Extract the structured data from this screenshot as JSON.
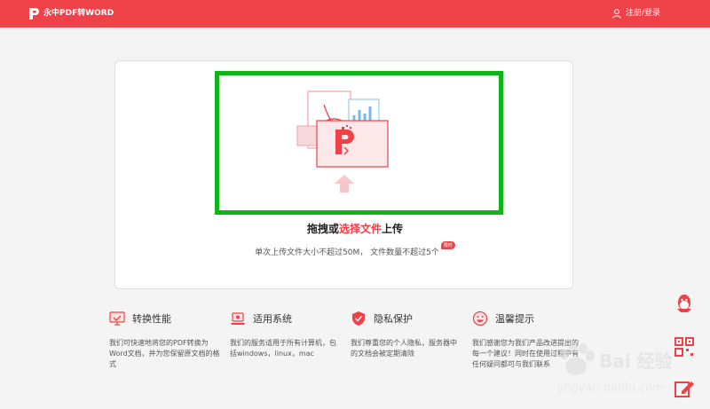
{
  "header": {
    "app_title": "永中PDF转WORD",
    "login_label": "注册/登录"
  },
  "upload": {
    "title_pre": "拖拽或",
    "title_link": "选择文件",
    "title_post": "上传",
    "note": "单次上传文件大小不超过50M， 文件数量不超过5个",
    "badge": "限时"
  },
  "features": [
    {
      "title": "转换性能",
      "icon": "monitor-check-icon",
      "desc": "我们可快速地将您的PDF转换为Word文档，并为您保留原文档的格式"
    },
    {
      "title": "适用系统",
      "icon": "laptop-icon",
      "desc": "我们的服务适用于所有计算机，包括windows，linux，mac"
    },
    {
      "title": "隐私保护",
      "icon": "shield-check-icon",
      "desc": "我们尊重您的个人隐私，服务器中的文档会被定期清除"
    },
    {
      "title": "温馨提示",
      "icon": "smile-icon",
      "desc": "我们感谢您为我们产品改进提出的每一个建议！同时在使用过程中有任何疑问都可与我们联系"
    }
  ],
  "watermark": {
    "text": "Bai 经验",
    "url": "jingyan.baidu.com"
  },
  "colors": {
    "accent": "#ee4148",
    "highlight": "#10b318"
  }
}
